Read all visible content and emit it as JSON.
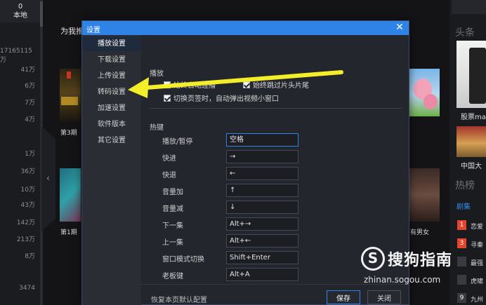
{
  "left_rail": {
    "top_count": "0",
    "top_label": "本地",
    "counts": [
      "17165115万",
      "41万",
      "6万",
      "7万",
      "4万",
      "1万",
      "36万",
      "10万",
      "43万",
      "142万",
      "213万",
      "8万",
      "3474"
    ]
  },
  "main": {
    "recommend_heading": "为我推荐",
    "captions": [
      "第3期",
      "第1期",
      "有男女"
    ]
  },
  "right_panel": {
    "heading1": "头条",
    "caption1": "股票ma",
    "caption2": "中国大",
    "heading2": "热榜",
    "tab": "剧集",
    "ranks": [
      {
        "rank": "1",
        "text": "恋爱",
        "color": "#e4452e"
      },
      {
        "rank": "3",
        "text": "寻秦",
        "color": "#e4452e"
      },
      {
        "rank": "",
        "text": "最强",
        "color": "#3a3b40"
      },
      {
        "rank": "",
        "text": "虎啸",
        "color": "#3a3b40"
      },
      {
        "rank": "9",
        "text": "九州",
        "color": "#3a3b40"
      }
    ]
  },
  "dialog": {
    "title": "设置",
    "close_glyph": "✕",
    "sidebar": [
      {
        "label": "播放设置",
        "active": true
      },
      {
        "label": "下载设置",
        "active": false
      },
      {
        "label": "上传设置",
        "active": false
      },
      {
        "label": "转码设置",
        "active": false
      },
      {
        "label": "加速设置",
        "active": false
      },
      {
        "label": "软件版本",
        "active": false
      },
      {
        "label": "其它设置",
        "active": false
      }
    ],
    "playback": {
      "section_title": "播放",
      "auto_continuous": {
        "label": "始终自动连播",
        "checked": true
      },
      "skip_intro_outro": {
        "label": "始终跳过片头片尾",
        "checked": true
      },
      "mini_window": {
        "label": "切换页签时，自动弹出视频小窗口",
        "checked": true
      }
    },
    "hotkeys": {
      "section_title": "热键",
      "items": [
        {
          "label": "播放/暂停",
          "value": "空格"
        },
        {
          "label": "快进",
          "value": "→"
        },
        {
          "label": "快退",
          "value": "←"
        },
        {
          "label": "音量加",
          "value": "↑"
        },
        {
          "label": "音量减",
          "value": "↓"
        },
        {
          "label": "下一集",
          "value": "Alt+→"
        },
        {
          "label": "上一集",
          "value": "Alt+←"
        },
        {
          "label": "窗口模式切换",
          "value": "Shift+Enter"
        },
        {
          "label": "老板键",
          "value": "Alt+A"
        }
      ]
    },
    "footer": {
      "restore_default": "恢复本页默认配置",
      "save": "保存",
      "close": "关闭"
    }
  },
  "colors": {
    "accent": "#2f83e6",
    "arrow": "#f4ee2a",
    "background": "#141417"
  },
  "watermark": {
    "logo_glyph": "S",
    "text": "搜狗指南",
    "url": "zhinan.sogou.com"
  }
}
